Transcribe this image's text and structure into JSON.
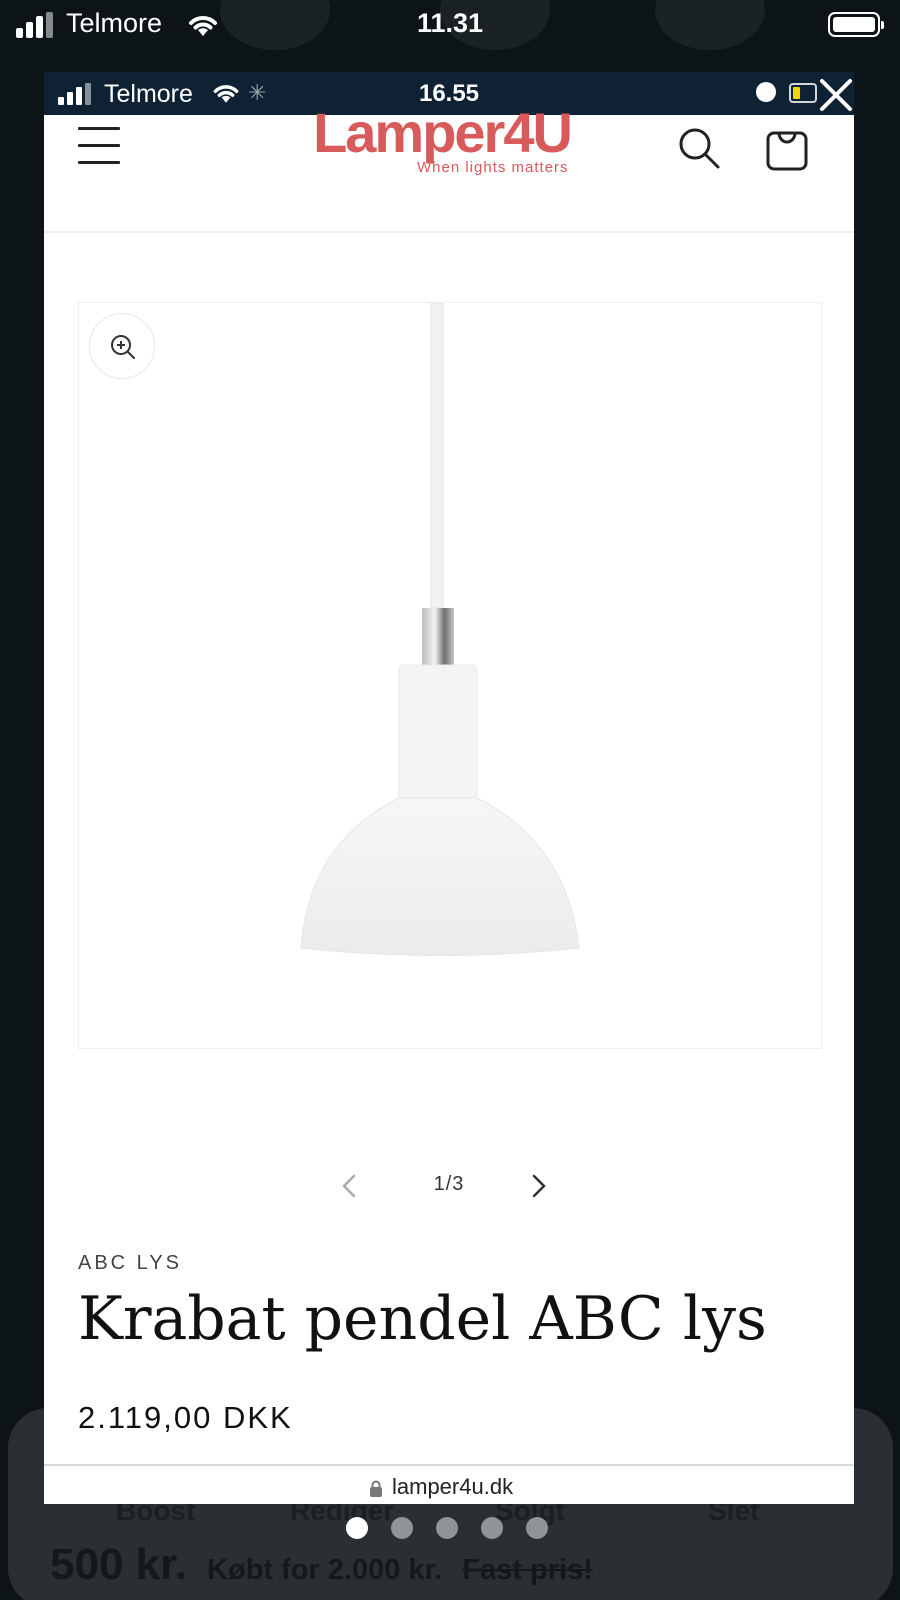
{
  "outer_status": {
    "carrier": "Telmore",
    "time": "11.31"
  },
  "inner_status": {
    "carrier": "Telmore",
    "time": "16.55"
  },
  "site": {
    "brand": "Lamper4U",
    "tagline": "When lights matters"
  },
  "gallery": {
    "current": "1/3"
  },
  "product": {
    "vendor": "ABC LYS",
    "title": "Krabat pendel ABC lys",
    "price": "2.119,00 DKK"
  },
  "browser": {
    "url": "lamper4u.dk"
  },
  "background_app": {
    "actions": [
      "Boost",
      "Rediger",
      "Solgt",
      "Slet"
    ],
    "price": "500 kr.",
    "bought_for": "Købt for 2.000 kr.",
    "fixed_price": "Fast pris!"
  },
  "page_indicator": {
    "total": 5,
    "active": 1
  },
  "colors": {
    "brand": "#d85a5a",
    "inner_status_bg": "#0f2233",
    "outer_bg": "#0d1418"
  },
  "icons": [
    "signal-icon",
    "wifi-icon",
    "battery-icon",
    "alarm-icon",
    "close-icon",
    "menu-icon",
    "search-icon",
    "cart-icon",
    "zoom-icon",
    "chevron-left-icon",
    "chevron-right-icon",
    "lock-icon"
  ]
}
